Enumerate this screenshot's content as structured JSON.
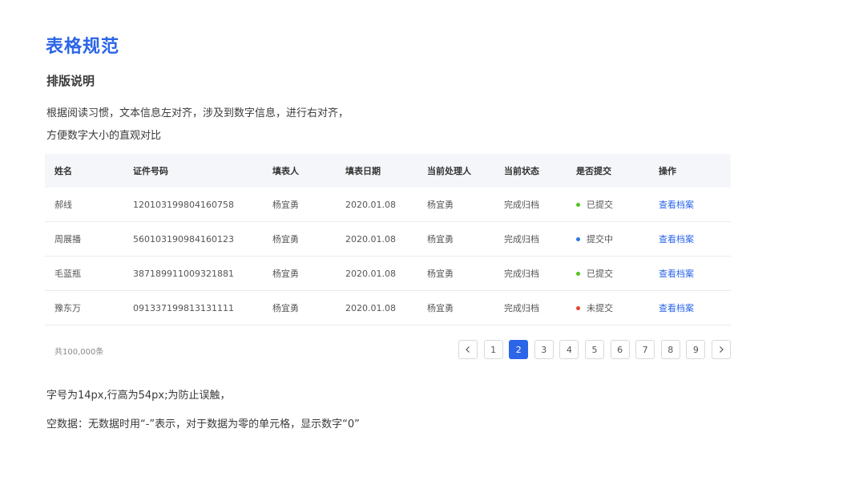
{
  "page": {
    "title": "表格规范",
    "section_title": "排版说明",
    "desc_line1": "根据阅读习惯，文本信息左对齐，涉及到数字信息，进行右对齐，",
    "desc_line2": "方便数字大小的直观对比",
    "note1": "字号为14px,行高为54px;为防止误触，",
    "note2": "空数据：无数据时用“-”表示，对于数据为零的单元格，显示数字“0”"
  },
  "table": {
    "headers": [
      "姓名",
      "证件号码",
      "填表人",
      "填表日期",
      "当前处理人",
      "当前状态",
      "是否提交",
      "操作"
    ],
    "rows": [
      [
        "郝线",
        "120103199804160758",
        "杨宜勇",
        "2020.01.08",
        "杨宜勇",
        "完成归档",
        "已提交",
        "查看档案"
      ],
      [
        "周展播",
        "560103190984160123",
        "杨宜勇",
        "2020.01.08",
        "杨宜勇",
        "完成归档",
        "提交中",
        "查看档案"
      ],
      [
        "毛蓝瓶",
        "387189911009321881",
        "杨宜勇",
        "2020.01.08",
        "杨宜勇",
        "完成归档",
        "已提交",
        "查看档案"
      ],
      [
        "豫东万",
        "091337199813131111",
        "杨宜勇",
        "2020.01.08",
        "杨宜勇",
        "完成归档",
        "未提交",
        "查看档案"
      ]
    ],
    "status_colors": {
      "已提交": "#52c41a",
      "提交中": "#2b78e4",
      "未提交": "#e8442e"
    }
  },
  "pagination": {
    "total_text": "共100,000条",
    "pages": [
      "1",
      "2",
      "3",
      "4",
      "5",
      "6",
      "7",
      "8",
      "9"
    ],
    "current": "2",
    "prev_icon": "chevron-left-icon",
    "next_icon": "chevron-right-icon"
  },
  "colors": {
    "accent": "#2b65e8",
    "header_bg": "#f4f6f9"
  }
}
